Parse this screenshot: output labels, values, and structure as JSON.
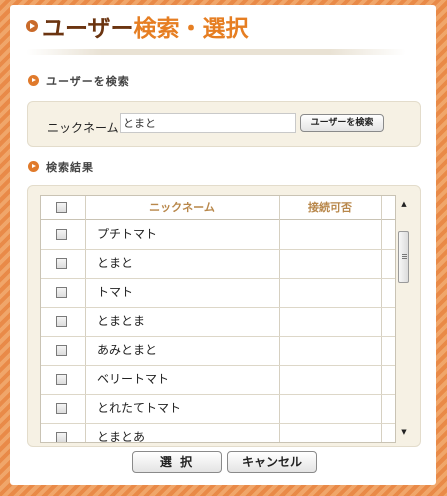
{
  "dialog": {
    "title_main": "ユーザー",
    "title_sub": "検索・選択"
  },
  "search_section": {
    "heading": "ユーザーを検索",
    "label": "ニックネーム",
    "input_value": "とまと",
    "button_label": "ユーザーを検索"
  },
  "results_section": {
    "heading": "検索結果",
    "columns": [
      "ニックネーム",
      "接続可否"
    ],
    "rows": [
      {
        "name": "プチトマト",
        "status": ""
      },
      {
        "name": "とまと",
        "status": ""
      },
      {
        "name": "トマト",
        "status": ""
      },
      {
        "name": "とまとま",
        "status": ""
      },
      {
        "name": "あみとまと",
        "status": ""
      },
      {
        "name": "ベリートマト",
        "status": ""
      },
      {
        "name": "とれたてトマト",
        "status": ""
      },
      {
        "name": "とまとあ",
        "status": ""
      }
    ]
  },
  "footer": {
    "select_label": "選 択",
    "cancel_label": "キャンセル"
  },
  "icons": {
    "title": "circle-arrow-icon",
    "section": "circle-arrow-icon",
    "scroll_up": "scroll-up-arrow-icon",
    "scroll_down": "scroll-down-arrow-icon"
  },
  "colors": {
    "background_stripes": [
      "#f0a66a",
      "#e98a48"
    ],
    "title_dark": "#6b3410",
    "title_accent": "#e67e22",
    "panel_background": "#f6f1e4",
    "header_text": "#b8874a",
    "bullet": "#e07a2b"
  }
}
